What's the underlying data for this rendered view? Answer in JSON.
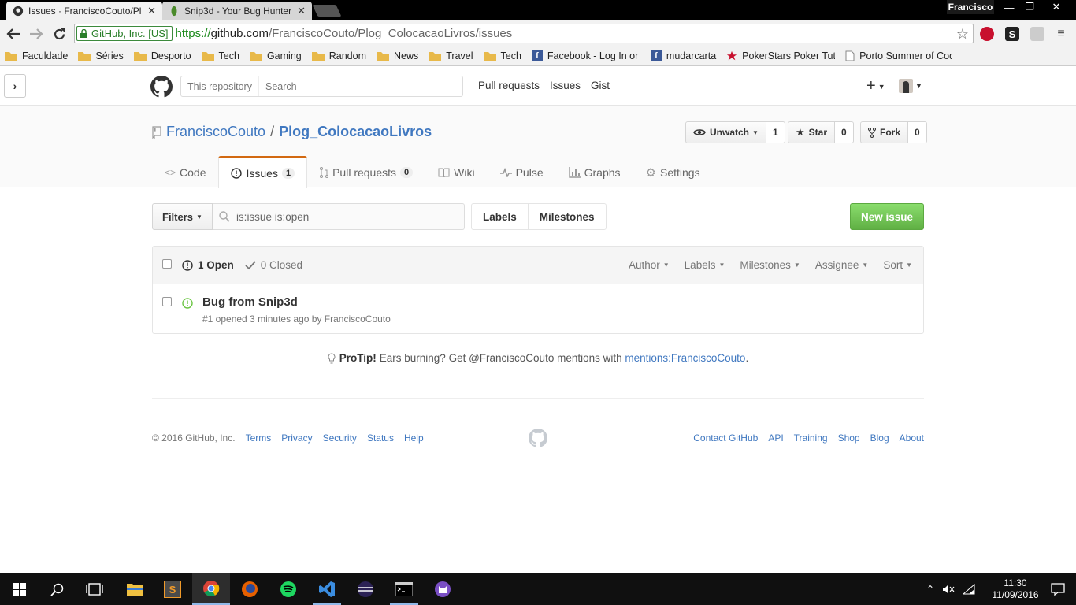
{
  "browser": {
    "tabs": [
      {
        "title": "Issues · FranciscoCouto/Pl",
        "active": true
      },
      {
        "title": "Snip3d - Your Bug Hunter",
        "active": false
      }
    ],
    "profile": "Francisco",
    "ev_cert": "GitHub, Inc. [US]",
    "url_scheme": "https://",
    "url_host": "github.com",
    "url_path": "/FranciscoCouto/Plog_ColocacaoLivros/issues",
    "bookmarks": [
      {
        "label": "Faculdade",
        "icon": "folder-icon"
      },
      {
        "label": "Séries",
        "icon": "folder-icon"
      },
      {
        "label": "Desporto",
        "icon": "folder-icon"
      },
      {
        "label": "Tech",
        "icon": "folder-icon"
      },
      {
        "label": "Gaming",
        "icon": "folder-icon"
      },
      {
        "label": "Random",
        "icon": "folder-icon"
      },
      {
        "label": "News",
        "icon": "folder-icon"
      },
      {
        "label": "Travel",
        "icon": "folder-icon"
      },
      {
        "label": "Tech",
        "icon": "folder-icon"
      },
      {
        "label": "Facebook - Log In or S",
        "icon": "facebook-icon"
      },
      {
        "label": "mudarcarta",
        "icon": "facebook-icon"
      },
      {
        "label": "PokerStars Poker Tuto",
        "icon": "pokerstars-icon"
      },
      {
        "label": "Porto Summer of Cod",
        "icon": "page-icon"
      }
    ]
  },
  "header": {
    "search_scope": "This repository",
    "search_placeholder": "Search",
    "nav": [
      "Pull requests",
      "Issues",
      "Gist"
    ]
  },
  "repo": {
    "owner": "FranciscoCouto",
    "separator": "/",
    "name": "Plog_ColocacaoLivros",
    "watch_label": "Unwatch",
    "watch_count": "1",
    "star_label": "Star",
    "star_count": "0",
    "fork_label": "Fork",
    "fork_count": "0",
    "tabs": [
      {
        "label": "Code",
        "icon": "code-icon"
      },
      {
        "label": "Issues",
        "icon": "issue-opened-icon",
        "counter": "1"
      },
      {
        "label": "Pull requests",
        "icon": "git-pull-request-icon",
        "counter": "0"
      },
      {
        "label": "Wiki",
        "icon": "book-icon"
      },
      {
        "label": "Pulse",
        "icon": "pulse-icon"
      },
      {
        "label": "Graphs",
        "icon": "graph-icon"
      },
      {
        "label": "Settings",
        "icon": "gear-icon"
      }
    ]
  },
  "issues": {
    "filters_label": "Filters",
    "filter_query": "is:issue is:open",
    "labels_label": "Labels",
    "milestones_label": "Milestones",
    "new_issue_label": "New issue",
    "open_label": "1 Open",
    "closed_label": "0 Closed",
    "table_filters": [
      "Author",
      "Labels",
      "Milestones",
      "Assignee",
      "Sort"
    ],
    "items": [
      {
        "title": "Bug from Snip3d",
        "meta": "#1 opened 3 minutes ago by FranciscoCouto"
      }
    ]
  },
  "protip": {
    "label": "ProTip!",
    "text": "Ears burning? Get @FranciscoCouto mentions with",
    "link": "mentions:FranciscoCouto",
    "end": "."
  },
  "footer": {
    "copyright": "© 2016 GitHub, Inc.",
    "left_links": [
      "Terms",
      "Privacy",
      "Security",
      "Status",
      "Help"
    ],
    "right_links": [
      "Contact GitHub",
      "API",
      "Training",
      "Shop",
      "Blog",
      "About"
    ]
  },
  "taskbar": {
    "time": "11:30",
    "date": "11/09/2016"
  },
  "colors": {
    "link": "#4078c0",
    "green": "#6cc644",
    "tab_accent": "#d26911"
  }
}
